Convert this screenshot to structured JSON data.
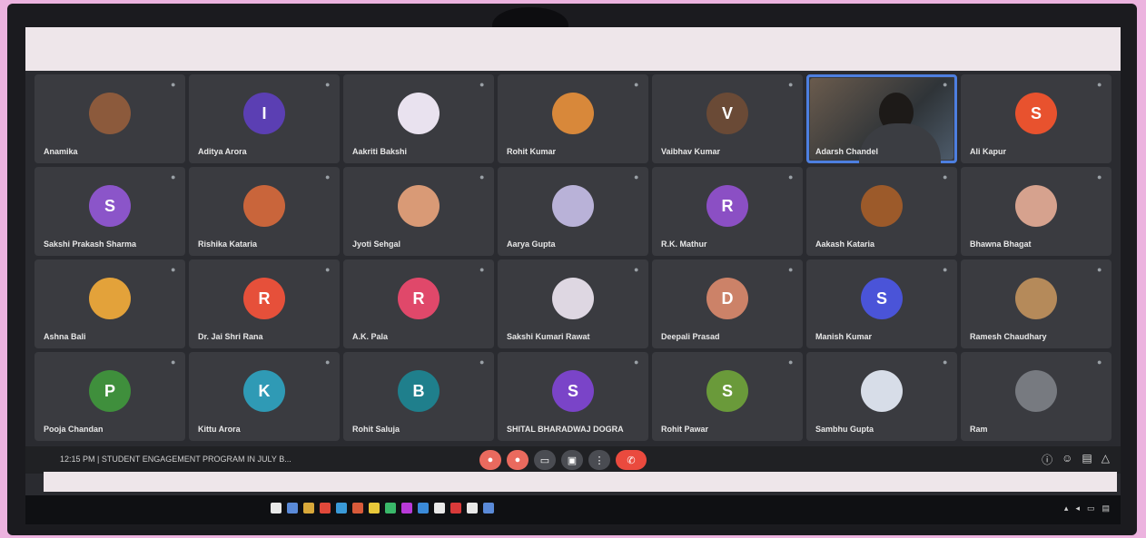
{
  "meeting": {
    "info": "12:15 PM | STUDENT ENGAGEMENT PROGRAM IN JULY B..."
  },
  "participants": [
    {
      "name": "Anamika",
      "avatar_letter": "",
      "color": "#8c5a3c"
    },
    {
      "name": "Aditya Arora",
      "avatar_letter": "I",
      "color": "#5b3fb3"
    },
    {
      "name": "Aakriti Bakshi",
      "avatar_letter": "",
      "color": "#e9e2ef"
    },
    {
      "name": "Rohit Kumar",
      "avatar_letter": "",
      "color": "#d8883a"
    },
    {
      "name": "Vaibhav Kumar",
      "avatar_letter": "V",
      "color": "#6a4a36"
    },
    {
      "name": "Adarsh Chandel",
      "avatar_letter": "",
      "color": "",
      "video": true
    },
    {
      "name": "Ali Kapur",
      "avatar_letter": "S",
      "color": "#e8522e"
    },
    {
      "name": "Sakshi Prakash Sharma",
      "avatar_letter": "S",
      "color": "#8b55c9"
    },
    {
      "name": "Rishika Kataria",
      "avatar_letter": "",
      "color": "#c9653b"
    },
    {
      "name": "Jyoti Sehgal",
      "avatar_letter": "",
      "color": "#d99a76"
    },
    {
      "name": "Aarya Gupta",
      "avatar_letter": "",
      "color": "#b9b2d8"
    },
    {
      "name": "R.K. Mathur",
      "avatar_letter": "R",
      "color": "#8b4fc4"
    },
    {
      "name": "Aakash Kataria",
      "avatar_letter": "",
      "color": "#9c5a2a"
    },
    {
      "name": "Bhawna Bhagat",
      "avatar_letter": "",
      "color": "#d6a28e"
    },
    {
      "name": "Ashna Bali",
      "avatar_letter": "",
      "color": "#e3a23a"
    },
    {
      "name": "Dr. Jai Shri Rana",
      "avatar_letter": "R",
      "color": "#e6503a"
    },
    {
      "name": "A.K. Pala",
      "avatar_letter": "R",
      "color": "#e0486a"
    },
    {
      "name": "Sakshi Kumari Rawat",
      "avatar_letter": "",
      "color": "#ded7e2"
    },
    {
      "name": "Deepali Prasad",
      "avatar_letter": "D",
      "color": "#cc8268"
    },
    {
      "name": "Manish Kumar",
      "avatar_letter": "S",
      "color": "#4a54d8"
    },
    {
      "name": "Ramesh Chaudhary",
      "avatar_letter": "",
      "color": "#b58a5a"
    },
    {
      "name": "Pooja Chandan",
      "avatar_letter": "P",
      "color": "#3f8f3c"
    },
    {
      "name": "Kittu Arora",
      "avatar_letter": "K",
      "color": "#2f9ab5"
    },
    {
      "name": "Rohit Saluja",
      "avatar_letter": "B",
      "color": "#1f7f8c"
    },
    {
      "name": "SHITAL BHARADWAJ DOGRA",
      "avatar_letter": "S",
      "color": "#7a44c8"
    },
    {
      "name": "Rohit Pawar",
      "avatar_letter": "S",
      "color": "#6a9a3a"
    },
    {
      "name": "Sambhu Gupta",
      "avatar_letter": "",
      "color": "#d7dde8"
    },
    {
      "name": "Ram",
      "avatar_letter": "",
      "color": "#777a80"
    }
  ],
  "controls": [
    {
      "icon": "mic-off-icon",
      "glyph": "●"
    },
    {
      "icon": "camera-off-icon",
      "glyph": "●"
    },
    {
      "icon": "captions-icon",
      "glyph": "▭"
    },
    {
      "icon": "present-icon",
      "glyph": "▣"
    },
    {
      "icon": "more-icon",
      "glyph": "⋮"
    },
    {
      "icon": "leave-call-icon",
      "glyph": "✆"
    }
  ],
  "right_controls": [
    "info-icon",
    "people-icon",
    "chat-icon",
    "activities-icon"
  ],
  "colors": {
    "wall": "#ecb3df",
    "tile": "#3a3b40",
    "active_outline": "#4d7fe0",
    "leave": "#ea4a3e"
  }
}
